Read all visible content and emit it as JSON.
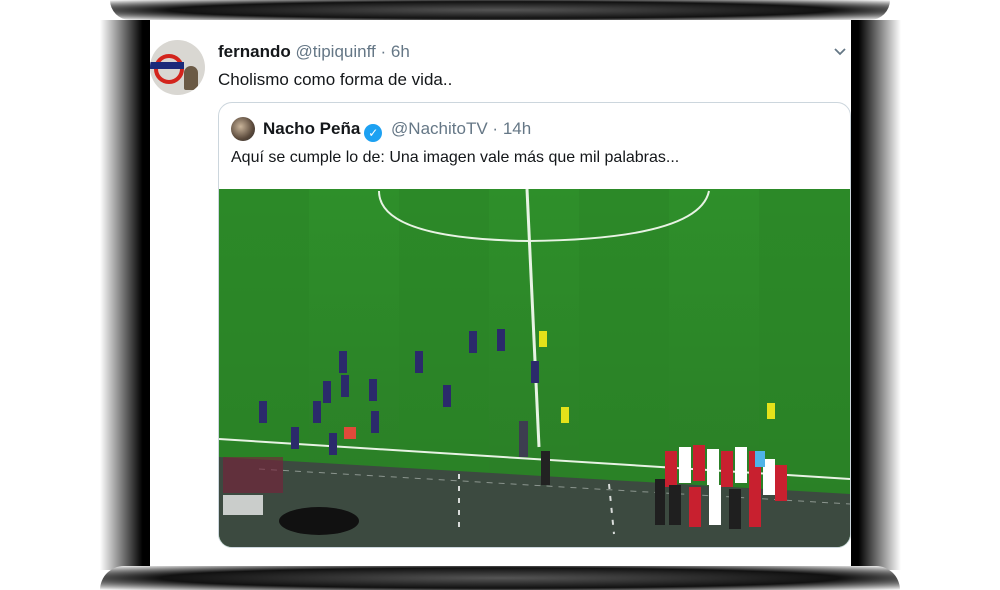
{
  "tweet": {
    "display_name": "fernando",
    "handle": "@tipiquinff",
    "separator": "·",
    "time": "6h",
    "text": "Cholismo como forma de vida..",
    "avatar_icon": "london-underground-roundel-icon"
  },
  "quoted_tweet": {
    "display_name": "Nacho Peña",
    "verified_icon": "verified-badge-icon",
    "handle": "@NachitoTV",
    "separator": "·",
    "time": "14h",
    "text": "Aquí se cumple lo de: Una imagen vale más que mil palabras...",
    "media_description_icon": "football-pitch-photo"
  },
  "icons": {
    "chevron": "chevron-down-icon"
  },
  "colors": {
    "pitch": "#2f8a2c",
    "pitch_dark": "#277a25",
    "team_a": "#2b2a6b",
    "team_b": "#c8202f",
    "referee": "#e4e21a",
    "link_gray": "#657786",
    "verified": "#1da1f2"
  }
}
